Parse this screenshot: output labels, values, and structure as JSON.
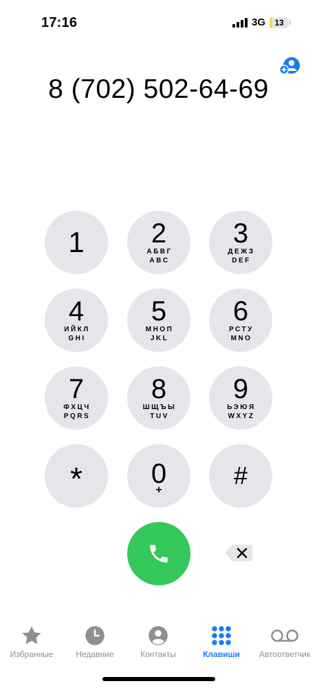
{
  "status_bar": {
    "time": "17:16",
    "network": "3G",
    "battery_percent": 13,
    "battery_label": "13",
    "signal_bars": 4
  },
  "dialer": {
    "phone_number": "8 (702) 502-64-69"
  },
  "keypad": [
    {
      "digit": "1",
      "letters_ru": "",
      "letters_en": ""
    },
    {
      "digit": "2",
      "letters_ru": "АБВГ",
      "letters_en": "ABC"
    },
    {
      "digit": "3",
      "letters_ru": "ДЕЖЗ",
      "letters_en": "DEF"
    },
    {
      "digit": "4",
      "letters_ru": "ИЙКЛ",
      "letters_en": "GHI"
    },
    {
      "digit": "5",
      "letters_ru": "МНОП",
      "letters_en": "JKL"
    },
    {
      "digit": "6",
      "letters_ru": "РСТУ",
      "letters_en": "MNO"
    },
    {
      "digit": "7",
      "letters_ru": "ФХЦЧ",
      "letters_en": "PQRS"
    },
    {
      "digit": "8",
      "letters_ru": "ШЩЪЫ",
      "letters_en": "TUV"
    },
    {
      "digit": "9",
      "letters_ru": "ЬЭЮЯ",
      "letters_en": "WXYZ"
    },
    {
      "digit": "*",
      "letters_ru": "",
      "letters_en": ""
    },
    {
      "digit": "0",
      "letters_ru": "",
      "letters_en": "+"
    },
    {
      "digit": "#",
      "letters_ru": "",
      "letters_en": ""
    }
  ],
  "actions": {
    "call_icon": "phone-icon",
    "delete_icon": "backspace-icon",
    "add_contact_icon": "add-contact-icon"
  },
  "tabs": [
    {
      "label": "Избранные",
      "icon": "star-icon",
      "active": false
    },
    {
      "label": "Недавние",
      "icon": "clock-icon",
      "active": false
    },
    {
      "label": "Контакты",
      "icon": "person-icon",
      "active": false
    },
    {
      "label": "Клавиши",
      "icon": "keypad-icon",
      "active": true
    },
    {
      "label": "Автоответчик",
      "icon": "voicemail-icon",
      "active": false
    }
  ],
  "colors": {
    "accent": "#1a7cf5",
    "call_green": "#34c759",
    "key_gray": "#e5e5ea",
    "inactive_tab": "#8e8e93",
    "battery_low": "#f6d84a"
  }
}
